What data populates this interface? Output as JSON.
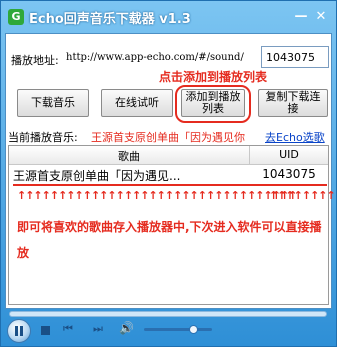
{
  "window": {
    "title": "Echo回声音乐下载器 v1.3",
    "icon_glyph": "G",
    "minimize_glyph": "—",
    "close_glyph": "✕"
  },
  "url": {
    "label": "播放地址:",
    "prefix": "http://www.app-echo.com/#/sound/",
    "value": "1043075"
  },
  "annotation_top": "点击添加到播放列表",
  "buttons": {
    "download": "下载音乐",
    "listen": "在线试听",
    "add_line1": "添加到播放",
    "add_line2": "列表",
    "copy_line1": "复制下载连",
    "copy_line2": "接"
  },
  "now_playing": {
    "label": "当前播放音乐:",
    "title": "王源首支原创单曲「因为遇见你",
    "link": "去Echo选歌"
  },
  "list": {
    "columns": [
      "歌曲",
      "UID"
    ],
    "rows": [
      {
        "song": "王源首支原创单曲「因为遇见...",
        "uid": "1043075"
      }
    ]
  },
  "annotation_arrows_left": "↑↑↑↑↑↑↑↑↑↑↑↑↑↑↑↑↑↑↑↑↑↑↑↑↑↑↑↑↑↑↑↑↑↑",
  "annotation_arrows_right": "↑↑↑↑↑↑↑↑",
  "annotation_note": "即可将喜欢的歌曲存入播放器中,下次进入软件可以直接播放",
  "player": {
    "volume": 0.65,
    "prev_glyph": "⏮",
    "next_glyph": "⏭",
    "speaker_glyph": "🔊"
  },
  "colors": {
    "annotation_red": "#e52b1f",
    "title_blue": "#2e8fd6",
    "link_blue": "#0a44c8"
  }
}
